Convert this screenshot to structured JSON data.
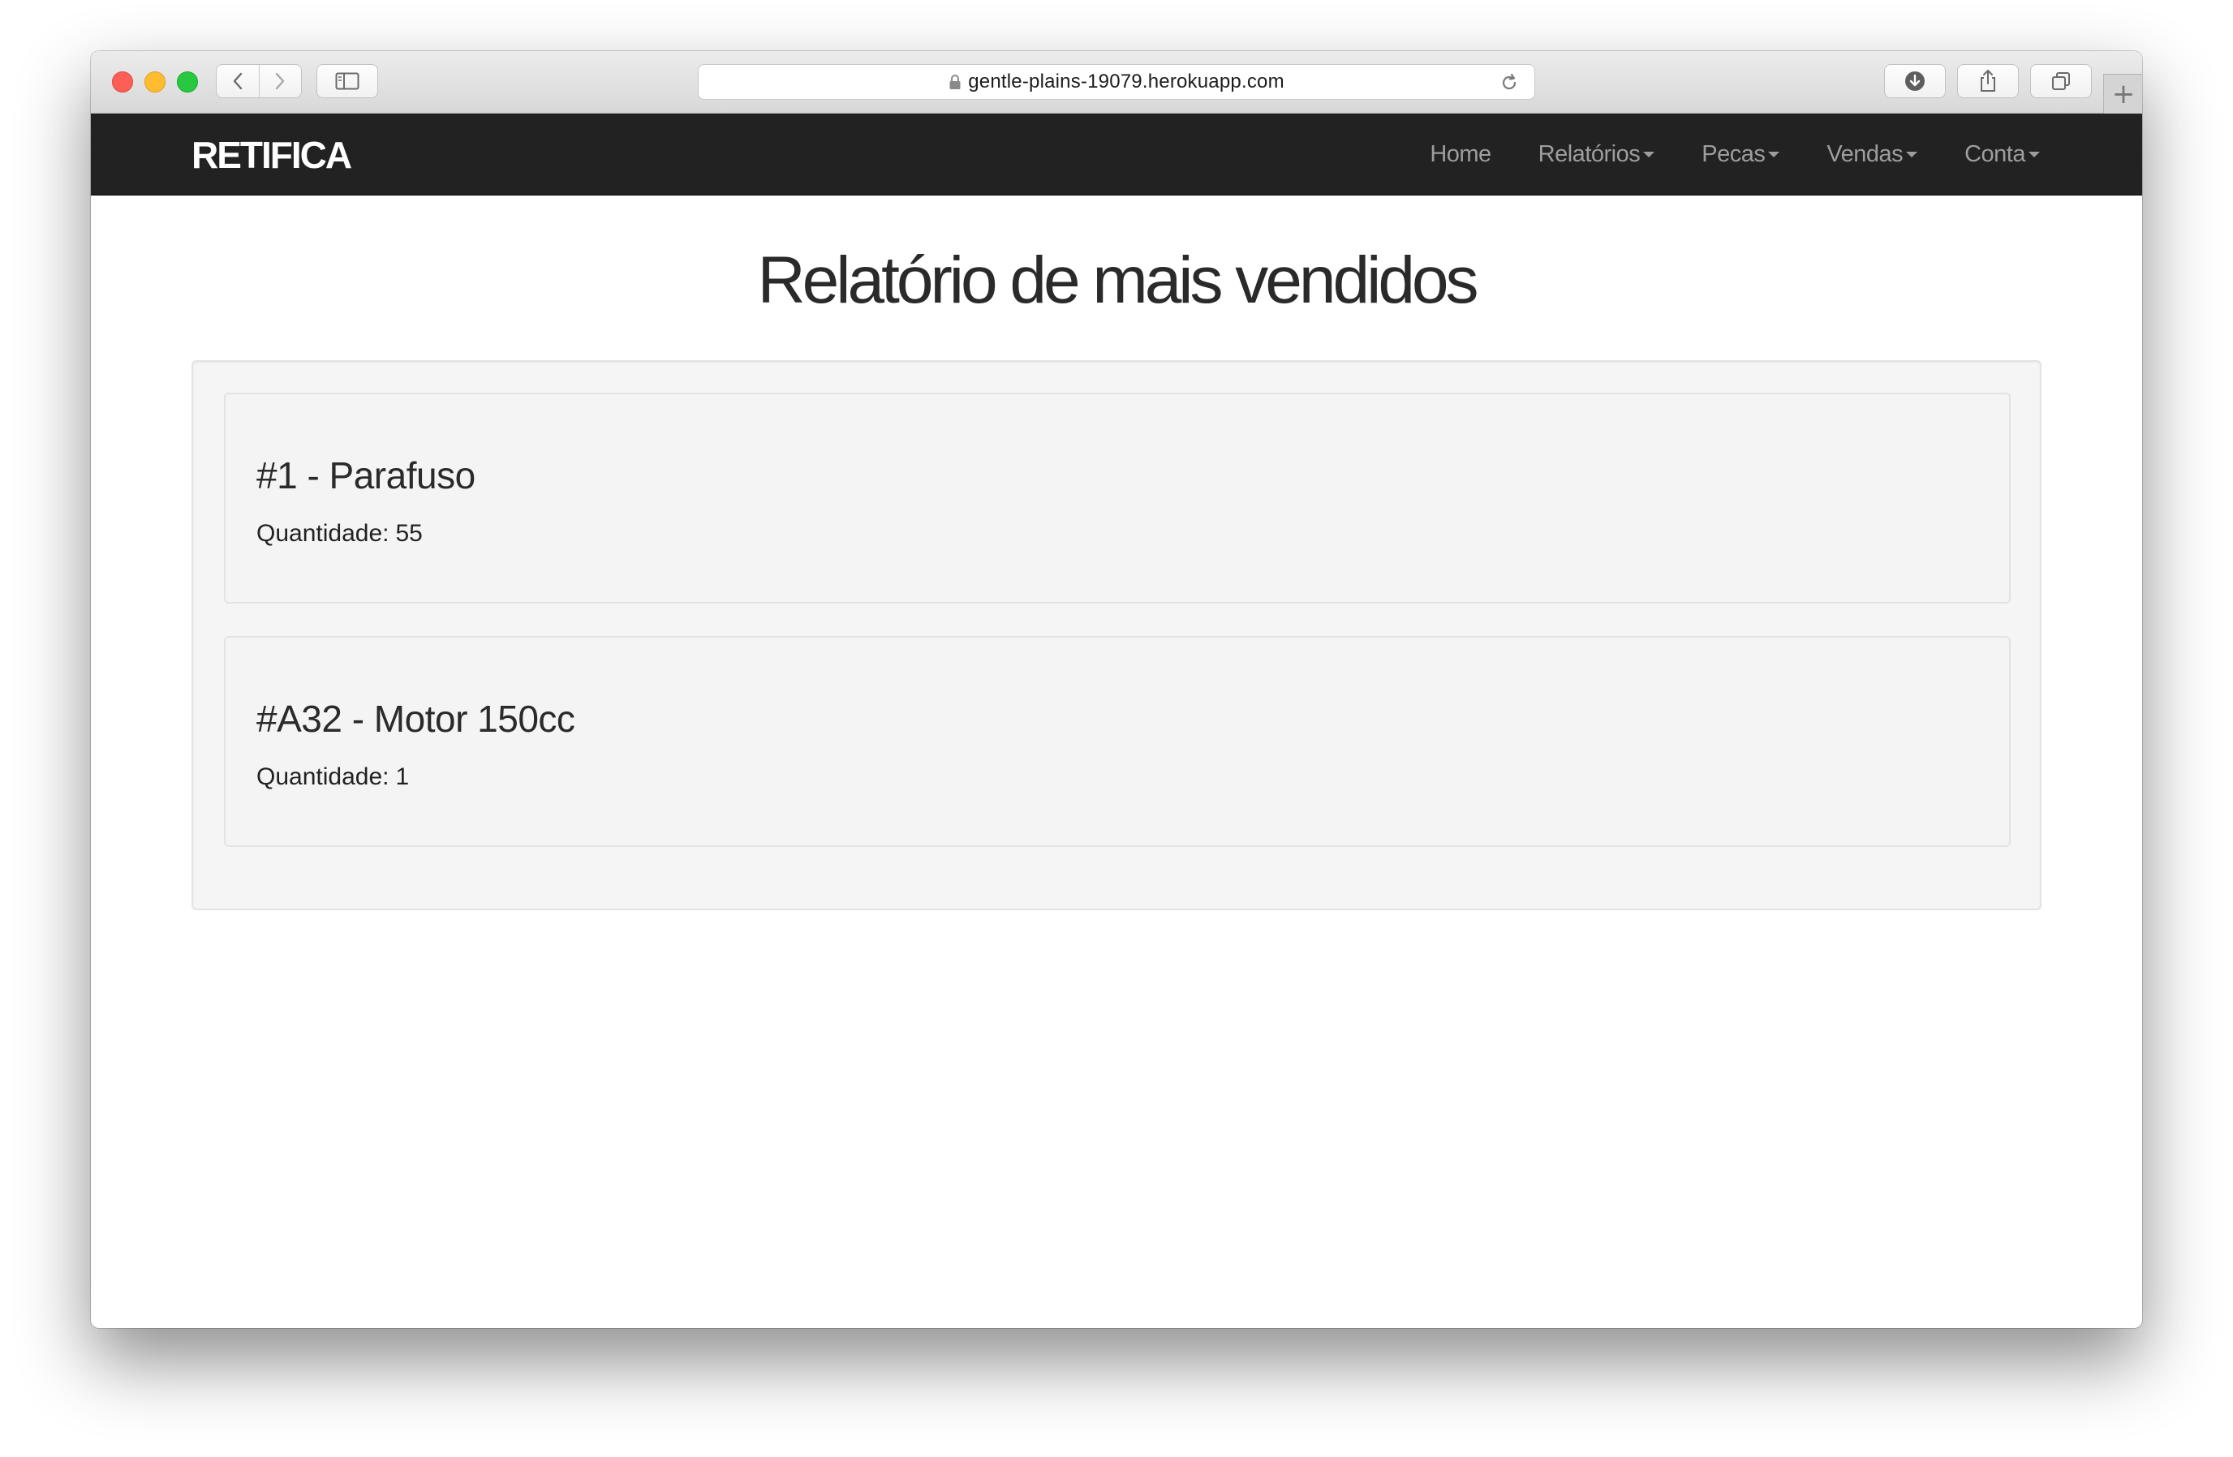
{
  "browser": {
    "url": "gentle-plains-19079.herokuapp.com",
    "new_tab_label": "+"
  },
  "navbar": {
    "brand": "RETIFICA",
    "items": [
      {
        "label": "Home",
        "dropdown": false
      },
      {
        "label": "Relatórios",
        "dropdown": true
      },
      {
        "label": "Pecas",
        "dropdown": true
      },
      {
        "label": "Vendas",
        "dropdown": true
      },
      {
        "label": "Conta",
        "dropdown": true
      }
    ]
  },
  "main": {
    "title": "Relatório de mais vendidos",
    "items": [
      {
        "title": "#1 - Parafuso",
        "qty_label": "Quantidade:",
        "qty": "55"
      },
      {
        "title": "#A32 - Motor 150cc",
        "qty_label": "Quantidade:",
        "qty": "1"
      }
    ]
  },
  "colors": {
    "navbar_bg": "#222222",
    "nav_text": "#9d9d9d",
    "well_bg": "#f5f5f5"
  }
}
